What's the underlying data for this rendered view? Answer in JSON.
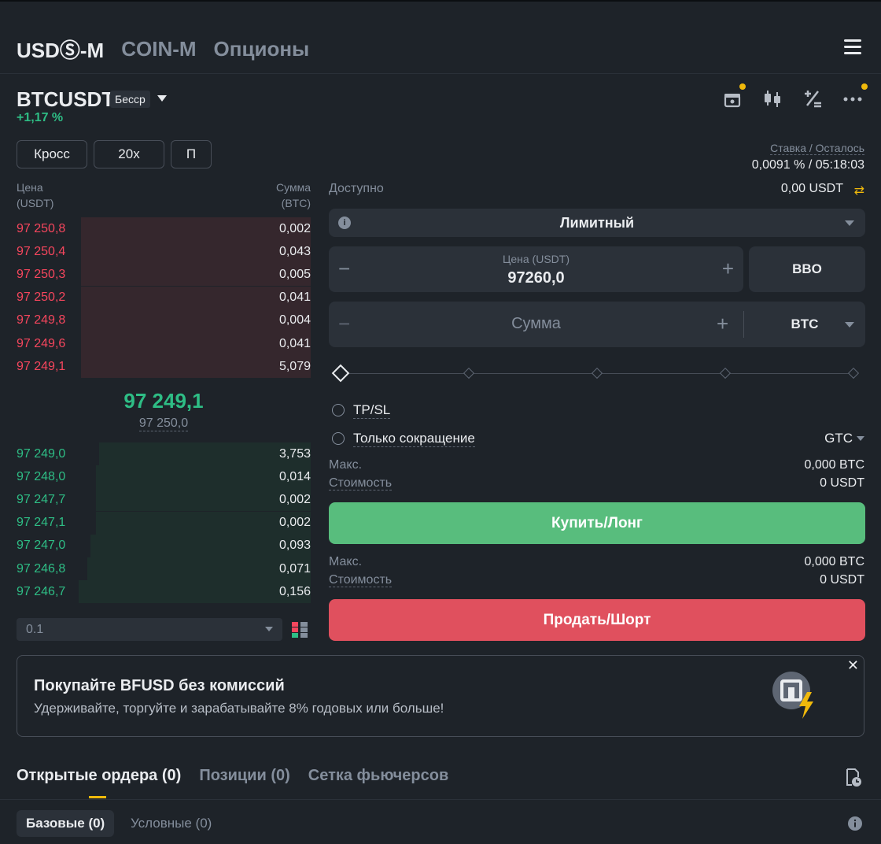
{
  "header": {
    "tabs": [
      {
        "label": "USDⓈ-M",
        "active": true
      },
      {
        "label": "COIN-M",
        "active": false
      },
      {
        "label": "Опционы",
        "active": false
      }
    ]
  },
  "symbol": {
    "name": "BTCUSDT",
    "badge": "Бесср",
    "change": "+1,17 %"
  },
  "margin": {
    "mode": "Кросс",
    "leverage": "20x",
    "position_mode": "П"
  },
  "orderbook": {
    "price_header": [
      "Цена",
      "(USDT)"
    ],
    "size_header": [
      "Сумма",
      "(BTC)"
    ],
    "asks": [
      {
        "price": "97 250,8",
        "size": "0,002",
        "depth": 0.78
      },
      {
        "price": "97 250,4",
        "size": "0,043",
        "depth": 0.78
      },
      {
        "price": "97 250,3",
        "size": "0,005",
        "depth": 0.78
      },
      {
        "price": "97 250,2",
        "size": "0,041",
        "depth": 0.78
      },
      {
        "price": "97 249,8",
        "size": "0,004",
        "depth": 0.78
      },
      {
        "price": "97 249,6",
        "size": "0,041",
        "depth": 0.78
      },
      {
        "price": "97 249,1",
        "size": "5,079",
        "depth": 0.78
      }
    ],
    "last_price": "97 249,1",
    "mark_price": "97 250,0",
    "bids": [
      {
        "price": "97 249,0",
        "size": "3,753",
        "depth": 0.72
      },
      {
        "price": "97 248,0",
        "size": "0,014",
        "depth": 0.73
      },
      {
        "price": "97 247,7",
        "size": "0,002",
        "depth": 0.73
      },
      {
        "price": "97 247,1",
        "size": "0,002",
        "depth": 0.73
      },
      {
        "price": "97 247,0",
        "size": "0,093",
        "depth": 0.75
      },
      {
        "price": "97 246,8",
        "size": "0,071",
        "depth": 0.76
      },
      {
        "price": "97 246,7",
        "size": "0,156",
        "depth": 0.79
      }
    ],
    "tick_size": "0.1"
  },
  "funding": {
    "label": "Ставка / Осталось",
    "value": "0,0091 % / 05:18:03"
  },
  "form": {
    "available_label": "Доступно",
    "available_value": "0,00 USDT",
    "order_type": "Лимитный",
    "price_label": "Цена (USDT)",
    "price_value": "97260,0",
    "bbo_label": "BBO",
    "amount_placeholder": "Сумма",
    "amount_unit": "BTC",
    "slider_percent": 0,
    "tpsl_label": "TP/SL",
    "reduce_only_label": "Только сокращение",
    "tif": "GTC",
    "buy": {
      "max_label": "Макс.",
      "max_value": "0,000 BTC",
      "cost_label": "Стоимость",
      "cost_value": "0 USDT",
      "button": "Купить/Лонг"
    },
    "sell": {
      "max_label": "Макс.",
      "max_value": "0,000 BTC",
      "cost_label": "Стоимость",
      "cost_value": "0 USDT",
      "button": "Продать/Шорт"
    }
  },
  "banner": {
    "title": "Покупайте BFUSD без комиссий",
    "subtitle": "Удерживайте, торгуйте и зарабатывайте 8% годовых или больше!",
    "close": "✕"
  },
  "bottom": {
    "tabs": [
      {
        "label": "Открытые ордера (0)",
        "active": true
      },
      {
        "label": "Позиции (0)",
        "active": false
      },
      {
        "label": "Сетка фьючерсов",
        "active": false
      }
    ],
    "subtabs": [
      {
        "label": "Базовые (0)",
        "active": true
      },
      {
        "label": "Условные (0)",
        "active": false
      }
    ]
  },
  "colors": {
    "bg": "#1e2329",
    "ask": "#f6465d",
    "bid": "#2ebd85",
    "accent": "#f0b90b",
    "buy_button": "#58bd7d",
    "sell_button": "#e0505e"
  },
  "icons": [
    "menu-icon",
    "gift-icon",
    "candlestick-icon",
    "percent-calc-icon",
    "more-icon",
    "swap-icon",
    "info-icon",
    "layout-icon",
    "history-icon",
    "bfusd-logo"
  ]
}
